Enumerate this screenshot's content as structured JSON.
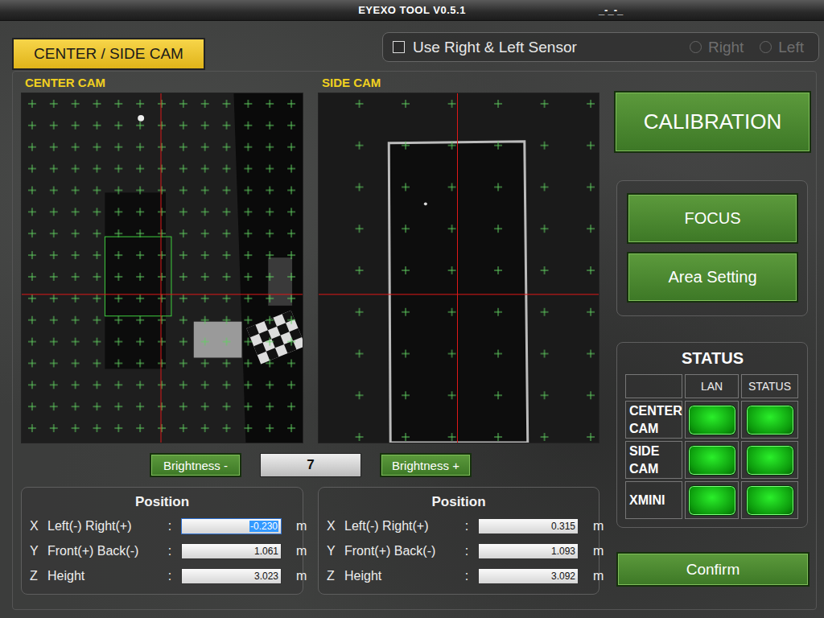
{
  "window": {
    "title": "EYEXO TOOL V0.5.1",
    "clock": "_-_-_"
  },
  "mode_tab": {
    "label": "CENTER / SIDE CAM",
    "selected": true
  },
  "sensor": {
    "label": "Use Right & Left Sensor",
    "checked": false,
    "options": [
      {
        "label": "Right",
        "selected": false,
        "disabled": true
      },
      {
        "label": "Left",
        "selected": false,
        "disabled": true
      }
    ]
  },
  "cameras": [
    {
      "label": "CENTER CAM",
      "kind": "center",
      "roi_visible": true,
      "position": {
        "title": "Position",
        "fields": [
          {
            "axis": "X",
            "label": "Left(-) Right(+)",
            "sep": ":",
            "value": "-0.230",
            "unit": "m",
            "selected": true
          },
          {
            "axis": "Y",
            "label": "Front(+) Back(-)",
            "sep": ":",
            "value": "1.061",
            "unit": "m",
            "selected": false
          },
          {
            "axis": "Z",
            "label": "Height",
            "sep": ":",
            "value": "3.023",
            "unit": "m",
            "selected": false
          }
        ]
      }
    },
    {
      "label": "SIDE CAM",
      "kind": "side",
      "roi_visible": false,
      "position": {
        "title": "Position",
        "fields": [
          {
            "axis": "X",
            "label": "Left(-) Right(+)",
            "sep": ":",
            "value": "0.315",
            "unit": "m",
            "selected": false
          },
          {
            "axis": "Y",
            "label": "Front(+) Back(-)",
            "sep": ":",
            "value": "1.093",
            "unit": "m",
            "selected": false
          },
          {
            "axis": "Z",
            "label": "Height",
            "sep": ":",
            "value": "3.092",
            "unit": "m",
            "selected": false
          }
        ]
      }
    }
  ],
  "brightness": {
    "decrease": "Brightness -",
    "value": "7",
    "increase": "Brightness +"
  },
  "actions": {
    "calibration": "CALIBRATION",
    "focus": "FOCUS",
    "area": "Area Setting",
    "confirm": "Confirm"
  },
  "status": {
    "title": "STATUS",
    "columns": [
      "LAN",
      "STATUS"
    ],
    "rows": [
      {
        "name": "CENTER CAM",
        "lan": true,
        "status": true
      },
      {
        "name": "SIDE CAM",
        "lan": true,
        "status": true
      },
      {
        "name": "XMINI",
        "lan": true,
        "status": true
      }
    ]
  }
}
